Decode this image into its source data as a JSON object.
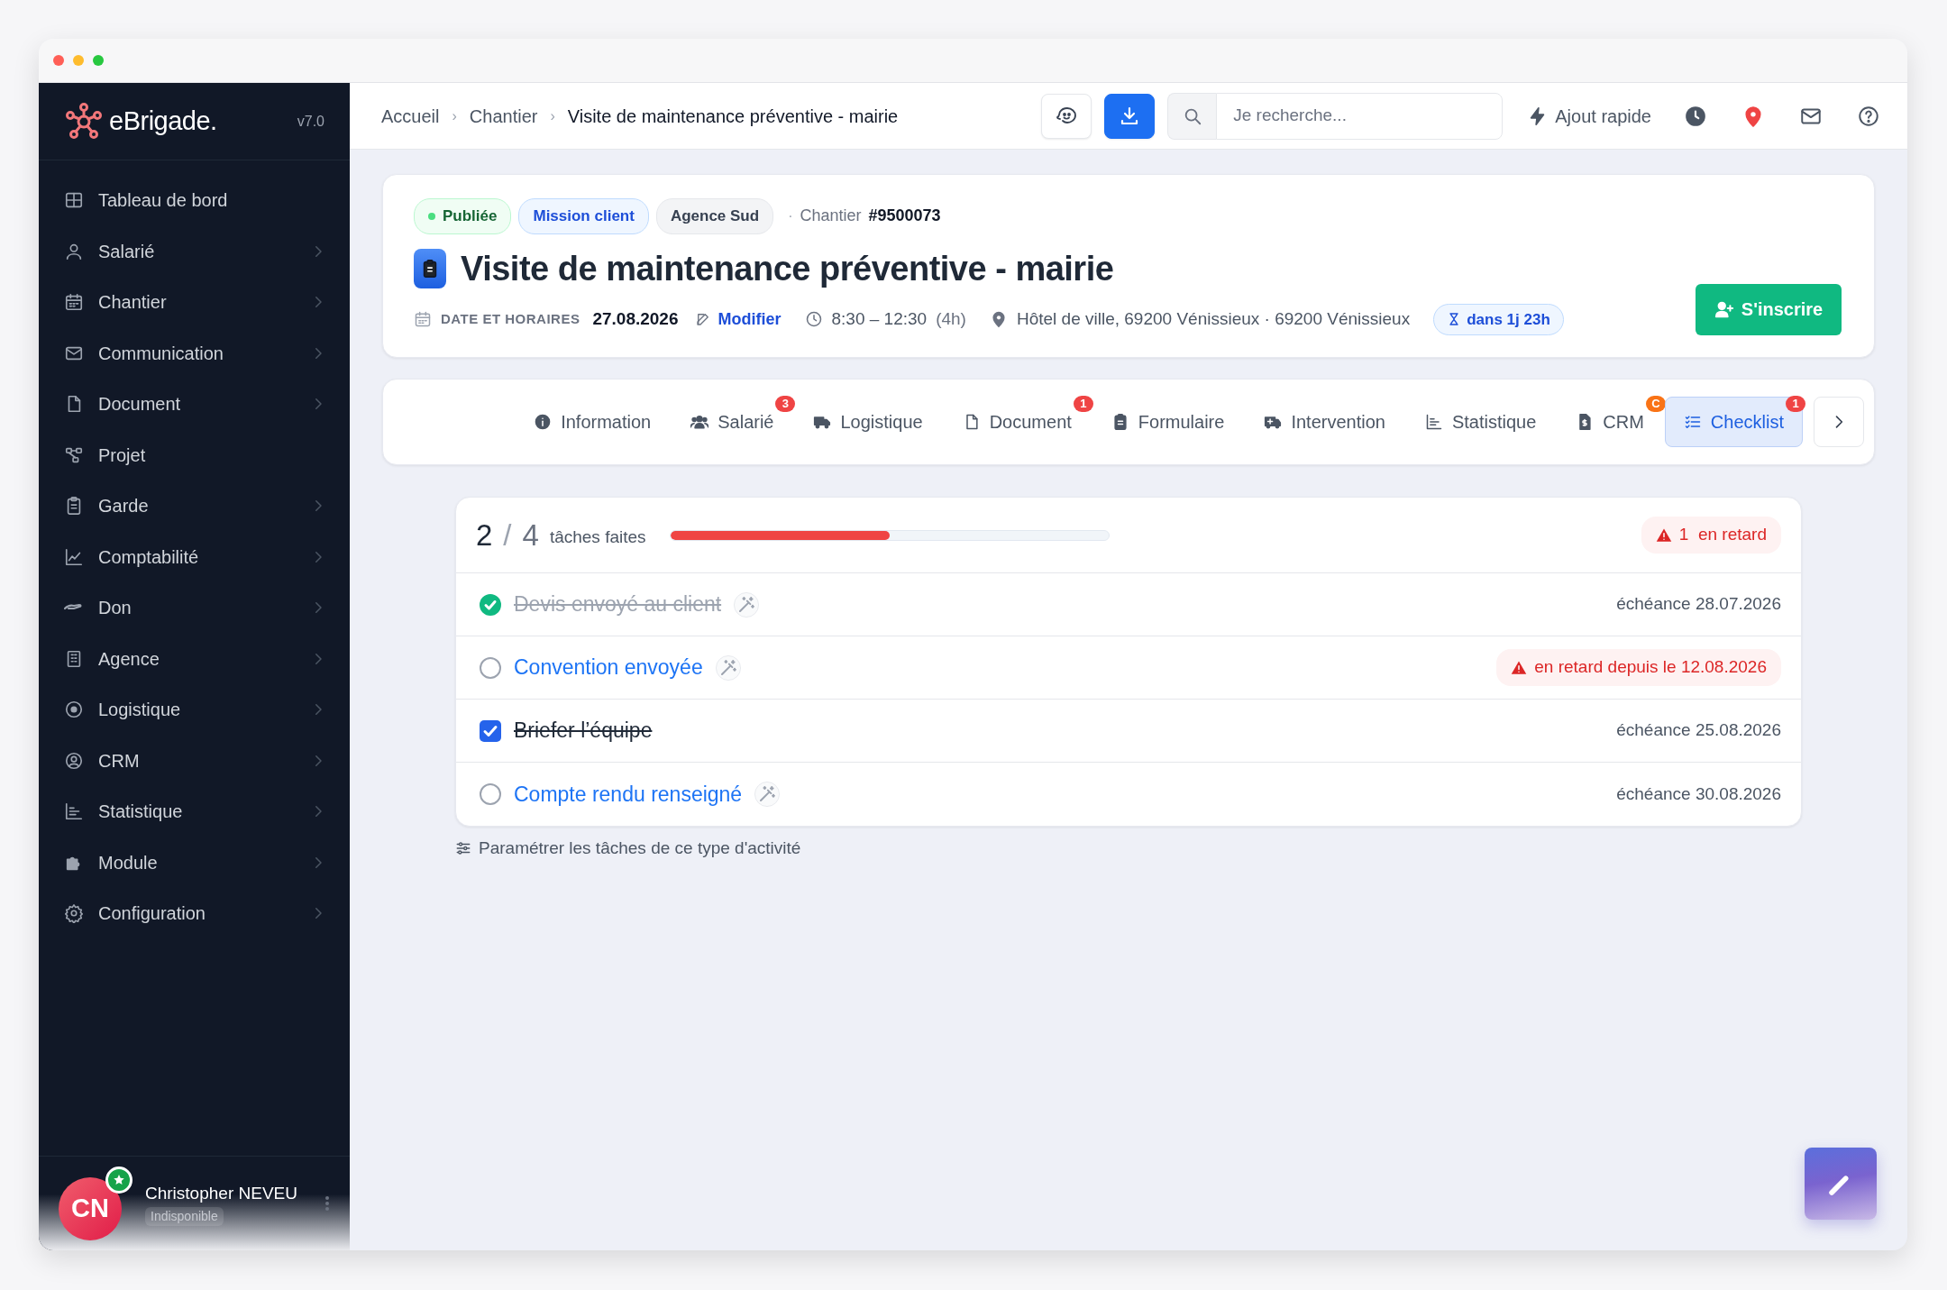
{
  "sidebar": {
    "brand": "eBrigade.",
    "version": "v7.0",
    "items": [
      {
        "label": "Tableau de bord",
        "has_submenu": false
      },
      {
        "label": "Salarié",
        "has_submenu": true
      },
      {
        "label": "Chantier",
        "has_submenu": true
      },
      {
        "label": "Communication",
        "has_submenu": true
      },
      {
        "label": "Document",
        "has_submenu": true
      },
      {
        "label": "Projet",
        "has_submenu": false
      },
      {
        "label": "Garde",
        "has_submenu": true
      },
      {
        "label": "Comptabilité",
        "has_submenu": true
      },
      {
        "label": "Don",
        "has_submenu": true
      },
      {
        "label": "Agence",
        "has_submenu": true
      },
      {
        "label": "Logistique",
        "has_submenu": true
      },
      {
        "label": "CRM",
        "has_submenu": true
      },
      {
        "label": "Statistique",
        "has_submenu": true
      },
      {
        "label": "Module",
        "has_submenu": true
      },
      {
        "label": "Configuration",
        "has_submenu": true
      }
    ],
    "user": {
      "initials": "CN",
      "name": "Christopher NEVEU",
      "status": "Indisponible"
    }
  },
  "topbar": {
    "breadcrumb": [
      {
        "label": "Accueil"
      },
      {
        "separator": "›",
        "label": "Chantier"
      },
      {
        "separator": "›",
        "label": "Visite de maintenance préventive - mairie"
      }
    ],
    "search": {
      "placeholder": "Je recherche..."
    },
    "quick_add": "Ajout rapide"
  },
  "event": {
    "badges": [
      {
        "label": "Publiée",
        "kind": "status"
      },
      {
        "label": "Mission client",
        "kind": "primary"
      },
      {
        "label": "Agence Sud",
        "kind": "neutral"
      }
    ],
    "separator": "·",
    "type_label": "Chantier",
    "number": "#9500073",
    "title": "Visite de maintenance préventive - mairie",
    "date_label": "DATE ET HORAIRES",
    "date": "27.08.2026",
    "edit_link": "Modifier",
    "time": "8:30 – 12:30",
    "duration": "(4h)",
    "location": "Hôtel de ville, 69200 Vénissieux · 69200 Vénissieux",
    "countdown": "dans 1j 23h",
    "register_button": "S'inscrire"
  },
  "tabs": [
    {
      "label": "Information",
      "selected": false
    },
    {
      "label": "Salarié",
      "selected": false,
      "badge": "3",
      "color": "#ef4444"
    },
    {
      "label": "Logistique",
      "selected": false
    },
    {
      "label": "Document",
      "selected": false,
      "badge": "1",
      "color": "#ef4444"
    },
    {
      "label": "Formulaire",
      "selected": false
    },
    {
      "label": "Intervention",
      "selected": false
    },
    {
      "label": "Statistique",
      "selected": false
    },
    {
      "label": "CRM",
      "selected": false,
      "badge": "C",
      "color": "#f97316"
    },
    {
      "label": "Checklist",
      "selected": true,
      "badge": "1",
      "color": "#ef4444"
    }
  ],
  "checklist": {
    "done": "2",
    "slash": "/",
    "total": "4",
    "summary": "tâches faites",
    "level": 0.5,
    "late_count": "1",
    "late_label": "en retard",
    "tasks": [
      {
        "label": "Devis envoyé au client",
        "kind": "auto",
        "done": true,
        "overdue": false,
        "due": "échéance 28.07.2026"
      },
      {
        "label": "Convention envoyée",
        "kind": "auto",
        "done": false,
        "overdue": true,
        "due": "en retard depuis le 12.08.2026"
      },
      {
        "label": "Briefer l’équipe",
        "kind": "manual",
        "done": true,
        "overdue": false,
        "due": "échéance 25.08.2026"
      },
      {
        "label": "Compte rendu renseigné",
        "kind": "auto",
        "done": false,
        "overdue": false,
        "due": "échéance 30.08.2026"
      }
    ],
    "settings_link": "Paramétrer les tâches de ce type d'activité"
  }
}
